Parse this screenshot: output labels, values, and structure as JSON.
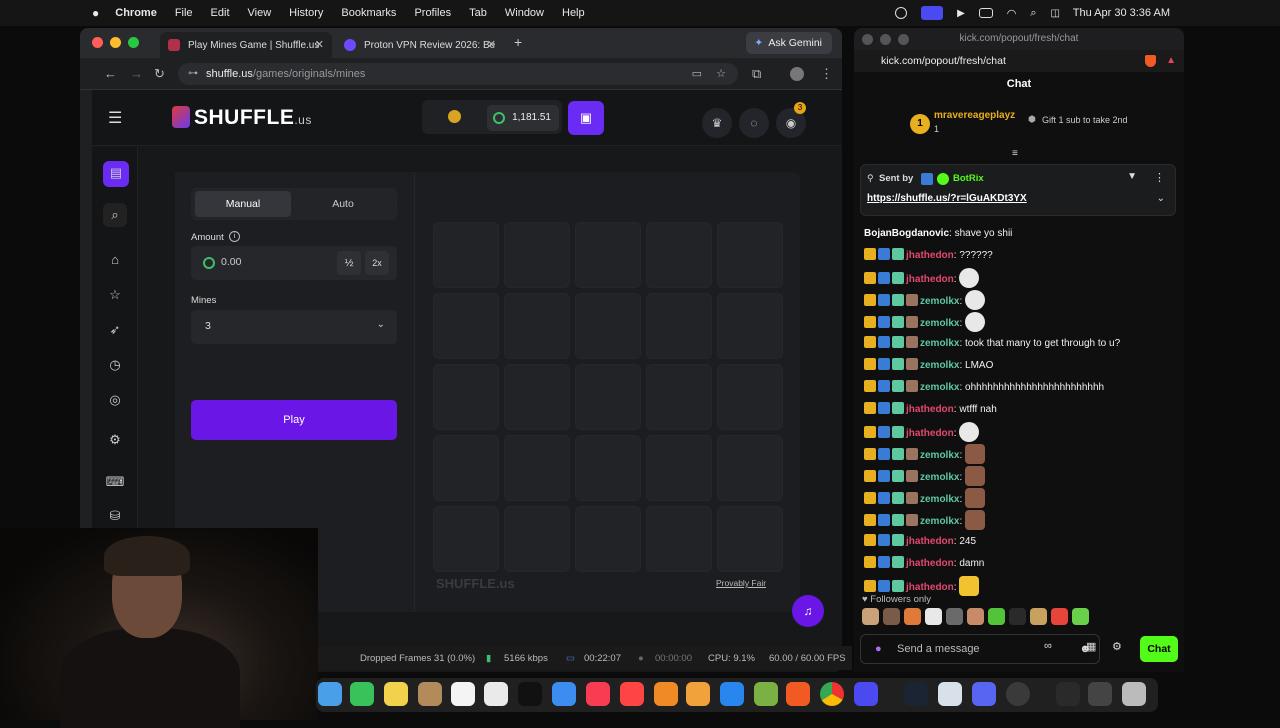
{
  "menubar": {
    "app": "Chrome",
    "items": [
      "File",
      "Edit",
      "View",
      "History",
      "Bookmarks",
      "Profiles",
      "Tab",
      "Window",
      "Help"
    ],
    "clock": "Thu Apr 30  3:36 AM"
  },
  "browser": {
    "tabs": [
      {
        "title": "Play Mines Game | Shuffle.us"
      },
      {
        "title": "Proton VPN Review 2026: Be"
      }
    ],
    "new_tab": "+",
    "gemini": "Ask Gemini",
    "url_host": "shuffle.us",
    "url_path": "/games/originals/mines"
  },
  "site": {
    "logo": "SHUFFLE",
    "logo_suffix": ".us",
    "balance": "1,181.51",
    "notification_count": "3",
    "mode_tabs": {
      "manual": "Manual",
      "auto": "Auto"
    },
    "amount_label": "Amount",
    "amount_value": "0.00",
    "half_label": "½",
    "double_label": "2x",
    "mines_label": "Mines",
    "mines_value": "3",
    "play_label": "Play",
    "footer_logo": "SHUFFLE.us",
    "provably_fair": "Provably Fair"
  },
  "status": {
    "dropped": "Dropped Frames 31 (0.0%)",
    "bitrate": "5166 kbps",
    "rec_time": "00:22:07",
    "stream_time": "00:00:00",
    "cpu": "CPU: 9.1%",
    "fps": "60.00 / 60.00 FPS"
  },
  "chat": {
    "window_title": "kick.com/popout/fresh/chat",
    "url": "kick.com/popout/fresh/chat",
    "header": "Chat",
    "gifter": {
      "rank": "1",
      "name": "mravereageplayz",
      "count": "1",
      "cta": "Gift 1 sub to take 2nd"
    },
    "pinned": {
      "sent_by": "Sent by",
      "author": "BotRix",
      "link": "https://shuffle.us/?r=lGuAKDt3YX"
    },
    "messages": [
      {
        "user": "BojanBogdanovic",
        "text": "shave yo shii",
        "style": "b"
      },
      {
        "user": "jhathedon",
        "text": "??????",
        "style": "j"
      },
      {
        "user": "jhathedon",
        "text": "",
        "style": "j",
        "emote": "skull"
      },
      {
        "user": "zemolkx",
        "text": "",
        "style": "z",
        "emote": "skull"
      },
      {
        "user": "zemolkx",
        "text": "",
        "style": "z",
        "emote": "skull"
      },
      {
        "user": "zemolkx",
        "text": "took that many to get through to u?",
        "style": "z"
      },
      {
        "user": "zemolkx",
        "text": "LMAO",
        "style": "z"
      },
      {
        "user": "zemolkx",
        "text": "ohhhhhhhhhhhhhhhhhhhhhhhh",
        "style": "z"
      },
      {
        "user": "jhathedon",
        "text": "wtfff nah",
        "style": "j"
      },
      {
        "user": "jhathedon",
        "text": "",
        "style": "j",
        "emote": "skull"
      },
      {
        "user": "zemolkx",
        "text": "",
        "style": "z",
        "emote": "face"
      },
      {
        "user": "zemolkx",
        "text": "",
        "style": "z",
        "emote": "face"
      },
      {
        "user": "zemolkx",
        "text": "",
        "style": "z",
        "emote": "face"
      },
      {
        "user": "zemolkx",
        "text": "",
        "style": "z",
        "emote": "face"
      },
      {
        "user": "jhathedon",
        "text": "245",
        "style": "j"
      },
      {
        "user": "jhathedon",
        "text": "damn",
        "style": "j"
      },
      {
        "user": "jhathedon",
        "text": "",
        "style": "j",
        "emote": "nerd"
      }
    ],
    "followers_only": "Followers only",
    "composer_placeholder": "Send a message",
    "send_label": "Chat"
  }
}
